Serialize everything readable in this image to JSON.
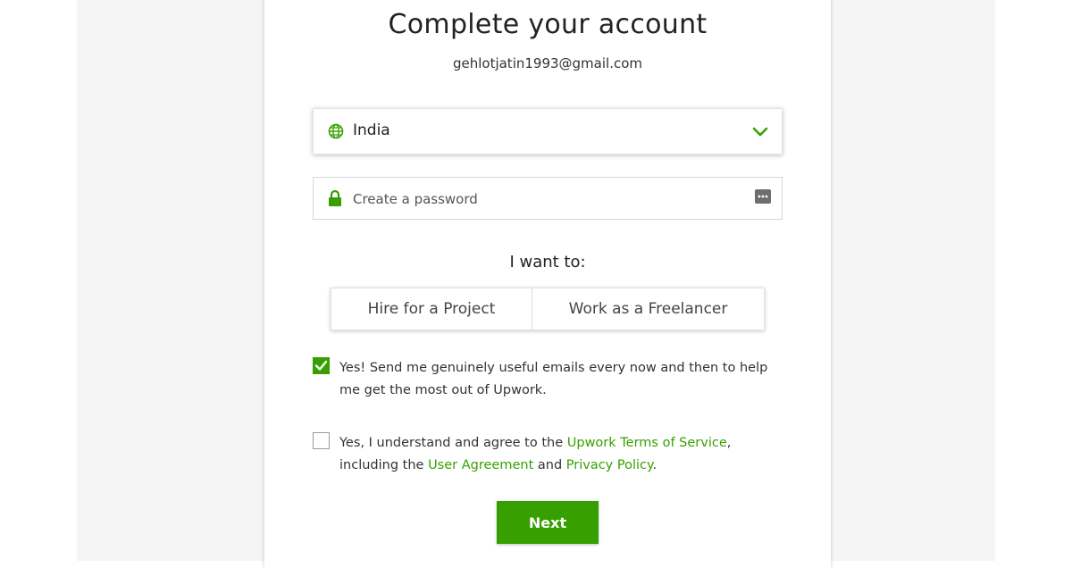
{
  "page": {
    "title": "Complete your account",
    "email": "gehlotjatin1993@gmail.com"
  },
  "country": {
    "selected": "India",
    "icon": "globe-icon",
    "dropdown_icon": "chevron-down-icon"
  },
  "password": {
    "placeholder": "Create a password",
    "value": "",
    "icon": "lock-icon",
    "reveal_icon": "password-dots-icon"
  },
  "role": {
    "label": "I want to:",
    "options": [
      "Hire for a Project",
      "Work as a Freelancer"
    ]
  },
  "consents": {
    "emails": {
      "checked": true,
      "text": "Yes! Send me genuinely useful emails every now and then to help me get the most out of Upwork."
    },
    "terms": {
      "checked": false,
      "prefix": "Yes, I understand and agree to the ",
      "terms_link": "Upwork Terms of Service",
      "middle": ", including the ",
      "agreement_link": "User Agreement",
      "and": " and ",
      "privacy_link": "Privacy Policy",
      "suffix": "."
    }
  },
  "actions": {
    "next_label": "Next"
  },
  "colors": {
    "accent": "#37a000",
    "background": "#f5f5f5"
  }
}
